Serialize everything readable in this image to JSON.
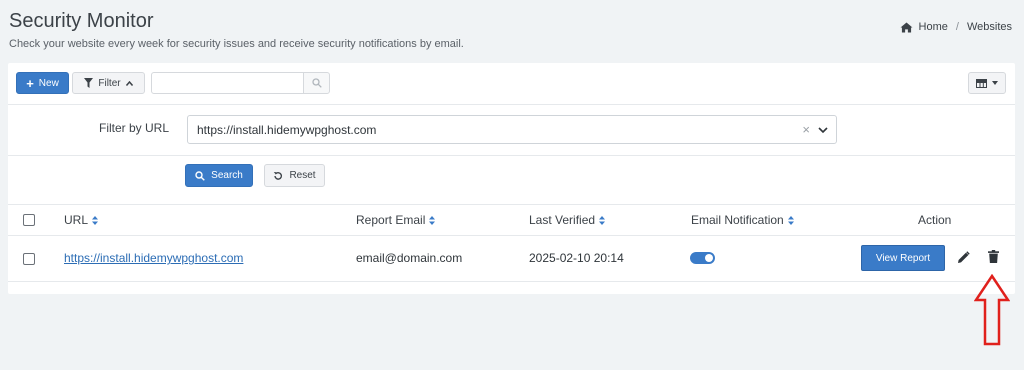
{
  "header": {
    "title": "Security Monitor",
    "subtitle": "Check your website every week for security issues and receive security notifications by email."
  },
  "breadcrumb": {
    "home": "Home",
    "separator": "/",
    "current": "Websites"
  },
  "toolbar": {
    "new_label": "New",
    "filter_label": "Filter",
    "search_value": ""
  },
  "filter": {
    "label": "Filter by URL",
    "selected_url": "https://install.hidemywpghost.com",
    "search_label": "Search",
    "reset_label": "Reset"
  },
  "table": {
    "columns": [
      "URL",
      "Report Email",
      "Last Verified",
      "Email Notification",
      "Action"
    ],
    "rows": [
      {
        "url": "https://install.hidemywpghost.com",
        "report_email": "email@domain.com",
        "last_verified": "2025-02-10 20:14",
        "email_notification": true,
        "view_label": "View Report"
      }
    ]
  },
  "colors": {
    "primary": "#3a7bc8",
    "link": "#2c6db5",
    "annotation": "#e0201c",
    "background": "#f0f3f5"
  },
  "icons": [
    "home-icon",
    "plus-icon",
    "filter-icon",
    "chevron-up-icon",
    "search-icon",
    "columns-icon",
    "caret-down-icon",
    "close-icon",
    "chevron-down-icon",
    "reset-icon",
    "sort-icon",
    "edit-icon",
    "trash-icon",
    "arrow-up-annotation"
  ]
}
